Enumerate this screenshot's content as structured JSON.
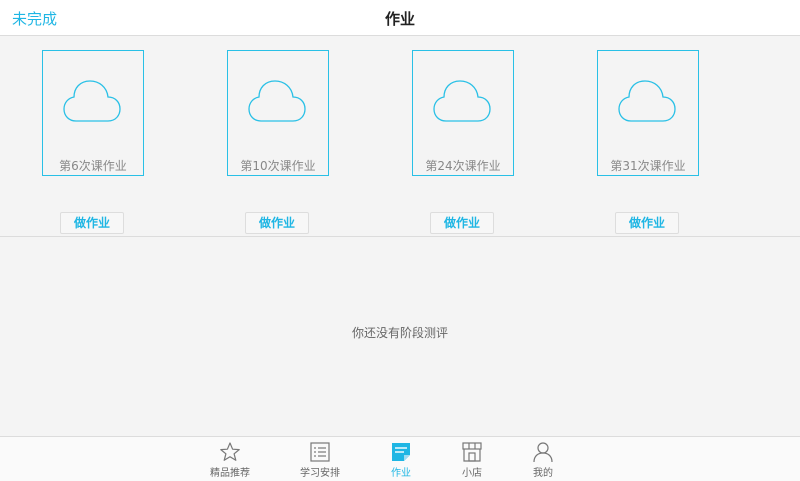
{
  "header": {
    "back_label": "未完成",
    "title": "作业"
  },
  "homework": [
    {
      "title": "第6次课作业",
      "button": "做作业"
    },
    {
      "title": "第10次课作业",
      "button": "做作业"
    },
    {
      "title": "第24次课作业",
      "button": "做作业"
    },
    {
      "title": "第31次课作业",
      "button": "做作业"
    }
  ],
  "empty_message": "你还没有阶段测评",
  "tabs": [
    {
      "label": "精品推荐",
      "icon": "star-icon"
    },
    {
      "label": "学习安排",
      "icon": "list-icon"
    },
    {
      "label": "作业",
      "icon": "homework-icon",
      "active": true
    },
    {
      "label": "小店",
      "icon": "shop-icon"
    },
    {
      "label": "我的",
      "icon": "person-icon"
    }
  ],
  "colors": {
    "accent": "#1fb6e4",
    "border": "#29c0e6",
    "background": "#f4f4f4"
  }
}
